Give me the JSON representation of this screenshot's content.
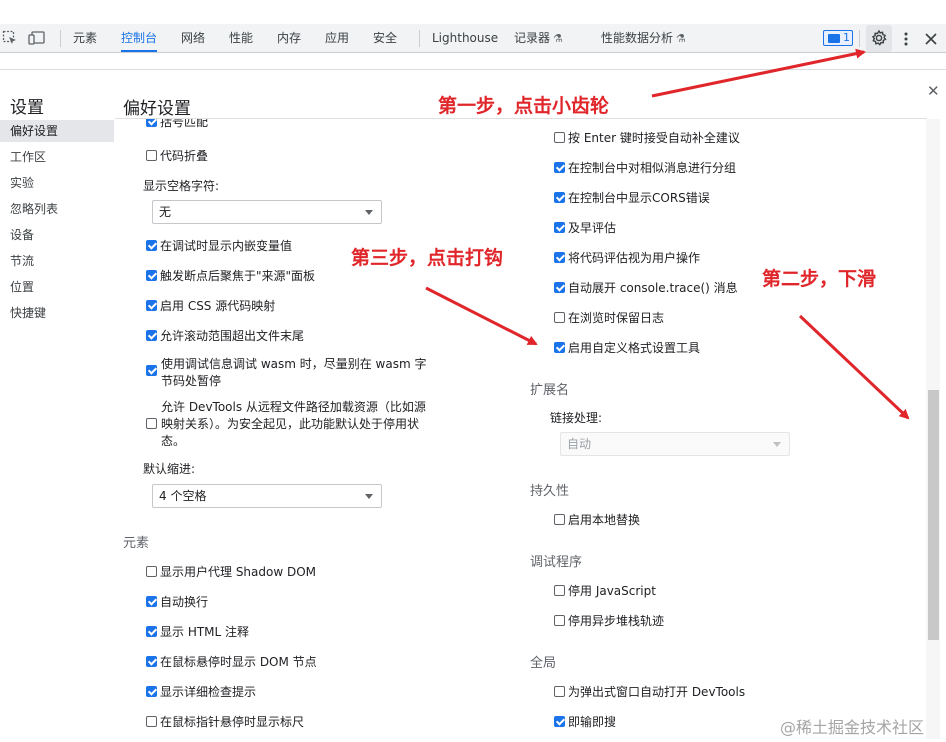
{
  "toolbar": {
    "tabs": [
      {
        "label": "元素"
      },
      {
        "label": "控制台"
      },
      {
        "label": "网络"
      },
      {
        "label": "性能"
      },
      {
        "label": "内存"
      },
      {
        "label": "应用"
      },
      {
        "label": "安全"
      },
      {
        "label": "Lighthouse"
      },
      {
        "label": "记录器"
      },
      {
        "label": "性能数据分析"
      }
    ],
    "message_count": "1"
  },
  "settings": {
    "panel_title": "设置",
    "sidebar": [
      {
        "label": "偏好设置"
      },
      {
        "label": "工作区"
      },
      {
        "label": "实验"
      },
      {
        "label": "忽略列表"
      },
      {
        "label": "设备"
      },
      {
        "label": "节流"
      },
      {
        "label": "位置"
      },
      {
        "label": "快捷键"
      }
    ],
    "main_title": "偏好设置",
    "left": {
      "partial_option": "括号匹配",
      "code_folding": "代码折叠",
      "whitespace_label": "显示空格字符:",
      "whitespace_value": "无",
      "options_a": [
        "在调试时显示内嵌变量值",
        "触发断点后聚焦于\"来源\"面板",
        "启用 CSS 源代码映射",
        "允许滚动范围超出文件末尾"
      ],
      "wasm_option": "使用调试信息调试 wasm 时，尽量别在 wasm 字节码处暂停",
      "remote_option": "允许 DevTools 从远程文件路径加载资源（比如源映射关系）。为安全起见，此功能默认处于停用状态。",
      "indent_label": "默认缩进:",
      "indent_value": "4 个空格",
      "elements_section": "元素",
      "elements_options": [
        "显示用户代理 Shadow DOM",
        "自动换行",
        "显示 HTML 注释",
        "在鼠标悬停时显示 DOM 节点",
        "显示详细检查提示",
        "在鼠标指针悬停时显示标尺"
      ]
    },
    "right": {
      "options": [
        "按 Enter 键时接受自动补全建议",
        "在控制台中对相似消息进行分组",
        "在控制台中显示CORS错误",
        "及早评估",
        "将代码评估视为用户操作",
        "自动展开 console.trace() 消息",
        "在浏览时保留日志",
        "启用自定义格式设置工具"
      ],
      "extensions_section": "扩展名",
      "link_handling_label": "链接处理:",
      "link_handling_value": "自动",
      "persistence_section": "持久性",
      "local_overrides": "启用本地替换",
      "debugger_section": "调试程序",
      "disable_js": "停用 JavaScript",
      "disable_async": "停用异步堆栈轨迹",
      "global_section": "全局",
      "auto_open_devtools": "为弹出式窗口自动打开 DevTools",
      "search_as_type": "即输即搜"
    }
  },
  "annotations": {
    "step1": "第一步，点击小齿轮",
    "step2": "第二步，下滑",
    "step3": "第三步，点击打钩"
  },
  "watermark": "@稀土掘金技术社区",
  "colors": {
    "accent": "#1a73e8",
    "annotation": "#e0262a"
  }
}
